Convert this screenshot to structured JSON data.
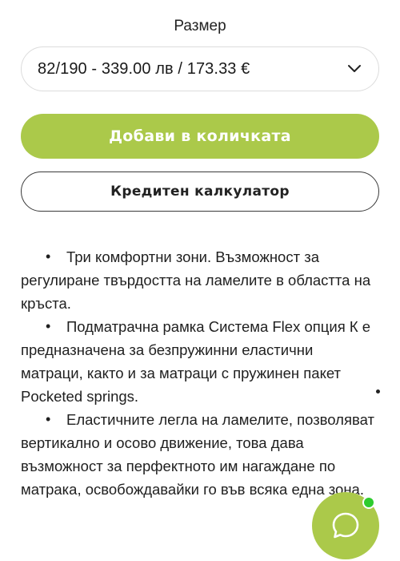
{
  "size": {
    "label": "Размер",
    "selected": "82/190 - 339.00 лв / 173.33 €"
  },
  "buttons": {
    "add_to_cart": "Добави в количката",
    "credit_calculator": "Кредитен калкулатор"
  },
  "features": [
    "Три комфортни зони. Възможност за регулиране твърдостта на ламелите в областта на кръста.",
    "Подматрачна рамка Система Flex опция К е предназначена за безпружинни еластични матраци, както и за матраци с пружинен пакет Pocketed springs.",
    "Еластичните легла на ламелите, позволяват вертикално и осово движение, това дава възможност за перфектното им нагаждане по матрака, освобождавайки го във всяка една зона."
  ],
  "colors": {
    "accent": "#abc94a",
    "online": "#2ecc2e"
  },
  "icons": {
    "dropdown": "chevron-down-icon",
    "chat": "chat-bubble-icon"
  }
}
